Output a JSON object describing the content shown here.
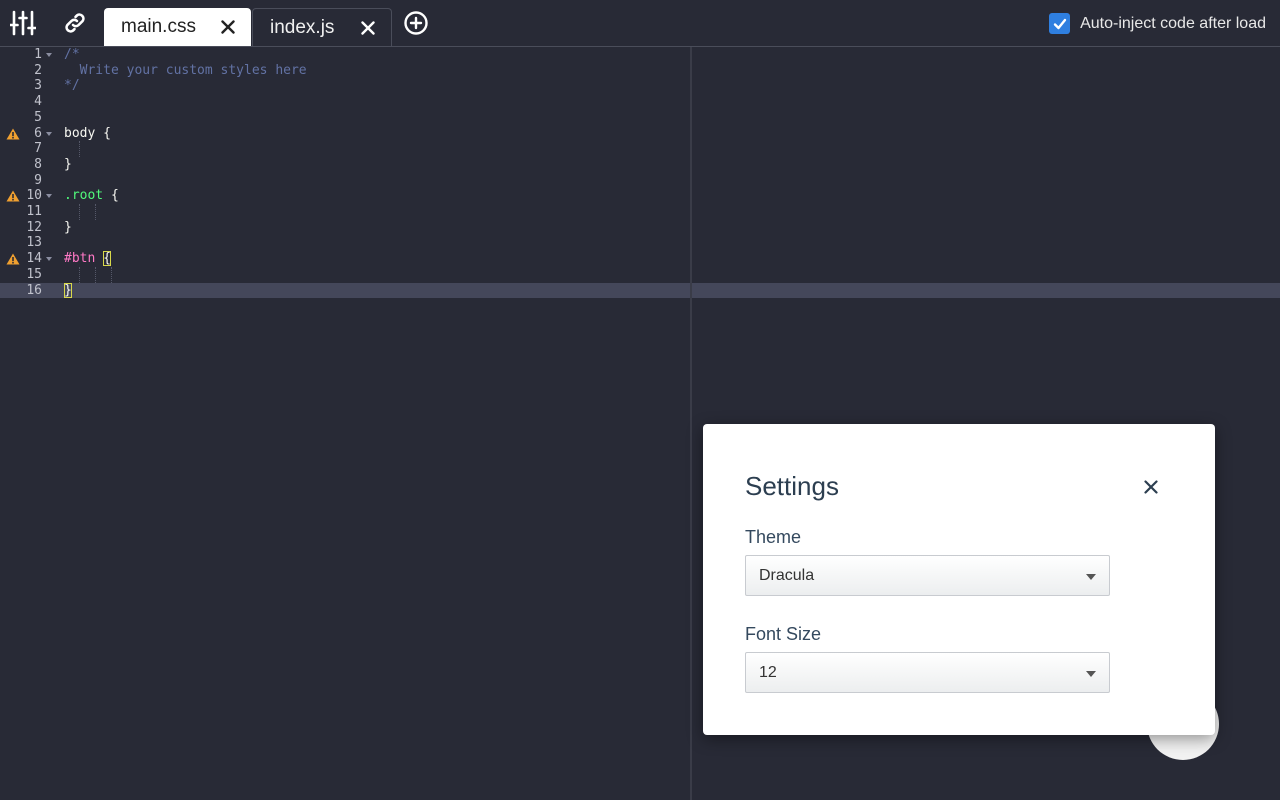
{
  "toolbar": {
    "settings_icon": "sliders-icon",
    "link_icon": "link-icon",
    "add_icon": "plus-circle-icon"
  },
  "tabs": [
    {
      "label": "main.css",
      "active": true
    },
    {
      "label": "index.js",
      "active": false
    }
  ],
  "auto_inject": {
    "label": "Auto-inject code after load",
    "checked": true
  },
  "editor": {
    "active_line": 16,
    "warning_lines": [
      6,
      10,
      14
    ],
    "lines": [
      {
        "n": "1",
        "text": "/*"
      },
      {
        "n": "2",
        "text": "  Write your custom styles here"
      },
      {
        "n": "3",
        "text": "*/"
      },
      {
        "n": "4",
        "text": ""
      },
      {
        "n": "5",
        "text": ""
      },
      {
        "n": "6",
        "text": "body {"
      },
      {
        "n": "7",
        "text": ""
      },
      {
        "n": "8",
        "text": "}"
      },
      {
        "n": "9",
        "text": ""
      },
      {
        "n": "10",
        "text": ".root {"
      },
      {
        "n": "11",
        "text": ""
      },
      {
        "n": "12",
        "text": "}"
      },
      {
        "n": "13",
        "text": ""
      },
      {
        "n": "14",
        "text": "#btn {"
      },
      {
        "n": "15",
        "text": ""
      },
      {
        "n": "16",
        "text": "}"
      }
    ]
  },
  "settings": {
    "title": "Settings",
    "theme_label": "Theme",
    "theme_value": "Dracula",
    "font_size_label": "Font Size",
    "font_size_value": "12"
  },
  "colors": {
    "background": "#282a36",
    "accent": "#2f7fe0",
    "warning": "#f0a030"
  }
}
